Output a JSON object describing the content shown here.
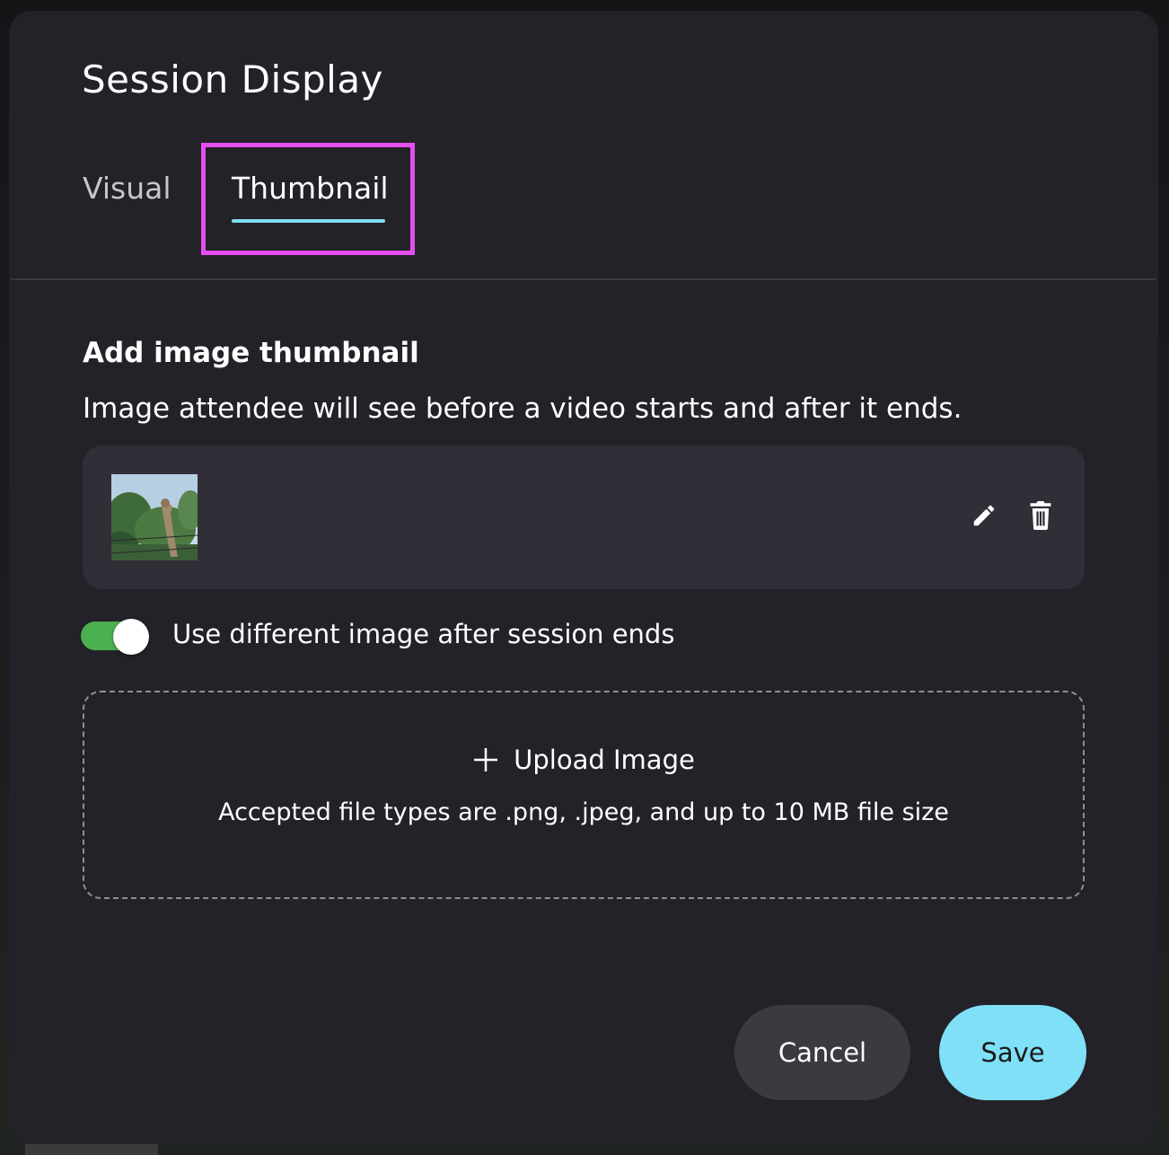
{
  "dialog": {
    "title": "Session Display",
    "tabs": [
      {
        "label": "Visual",
        "active": false
      },
      {
        "label": "Thumbnail",
        "active": true
      }
    ],
    "section": {
      "heading": "Add image thumbnail",
      "description": "Image attendee will see before a video starts and after it ends."
    },
    "thumbnail": {
      "image_icon": "giraffe-photo",
      "edit_icon": "pencil-icon",
      "delete_icon": "trash-icon"
    },
    "toggle": {
      "label": "Use different image after session ends",
      "on": true,
      "on_color": "#4caf50"
    },
    "upload": {
      "label": "Upload Image",
      "icon": "plus-icon",
      "note": "Accepted file types are .png, .jpeg, and up to 10 MB file size"
    },
    "buttons": {
      "cancel": "Cancel",
      "save": "Save"
    }
  },
  "colors": {
    "dialog_bg": "#232228",
    "card_bg": "#302f38",
    "accent": "#7fe0f8",
    "tab_highlight": "#e54ff0"
  }
}
